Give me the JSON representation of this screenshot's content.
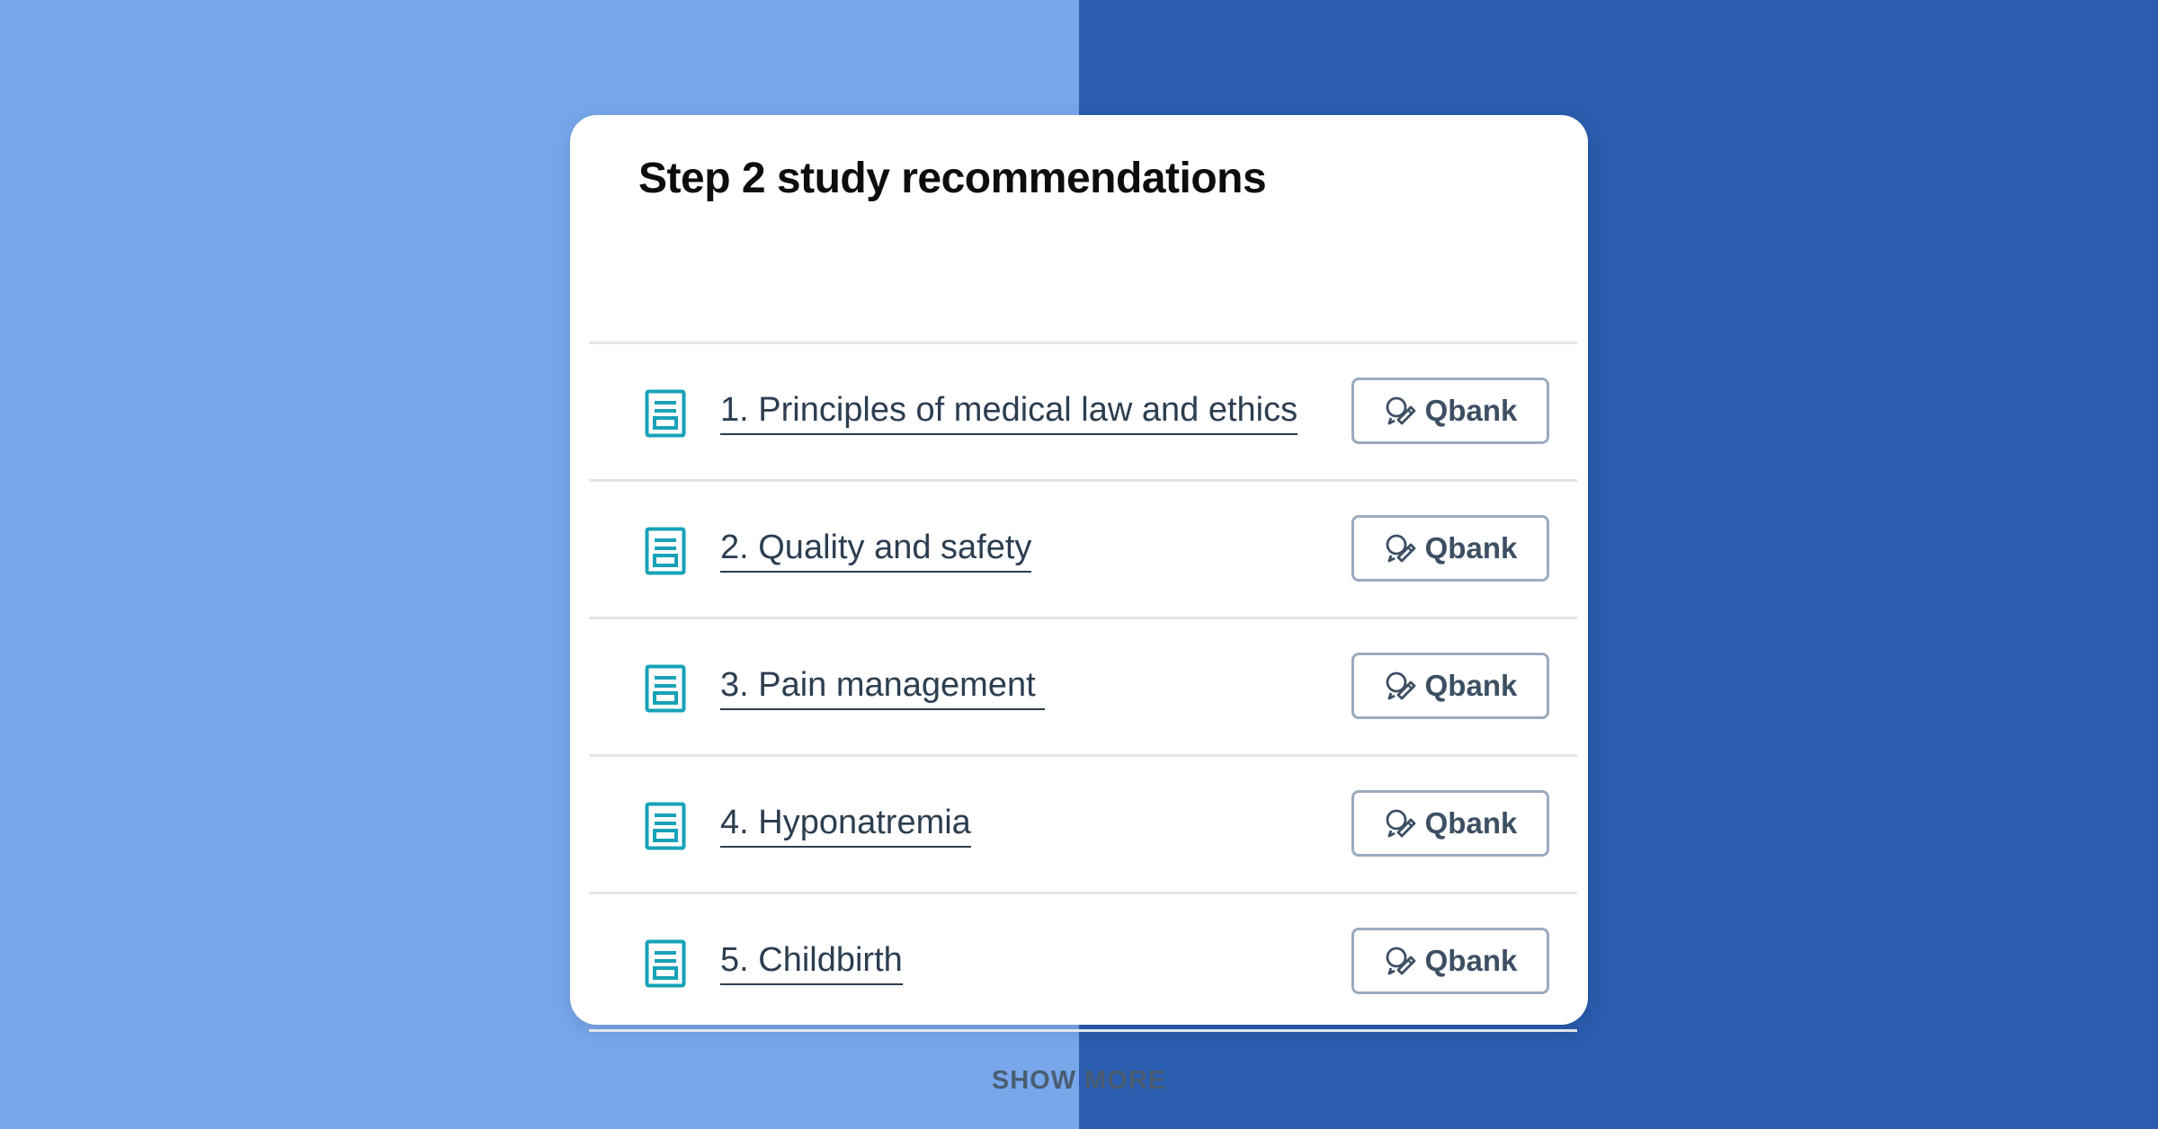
{
  "card": {
    "title": "Step 2 study recommendations"
  },
  "items": [
    {
      "label": "1. Principles of medical law and ethics",
      "button": "Qbank",
      "icon": "document-icon"
    },
    {
      "label": "2. Quality and safety",
      "button": "Qbank",
      "icon": "document-icon"
    },
    {
      "label": "3. Pain management ",
      "button": "Qbank",
      "icon": "document-icon"
    },
    {
      "label": "4. Hyponatremia",
      "button": "Qbank",
      "icon": "document-icon"
    },
    {
      "label": "5. Childbirth",
      "button": "Qbank",
      "icon": "document-icon"
    }
  ],
  "show_more_label": "SHOW MORE",
  "colors": {
    "background_left": "#78a7ec",
    "background_right": "#2a5caf",
    "icon_teal": "#17a2b8",
    "link_text": "#2c3e50",
    "button_border": "#9aabbd"
  }
}
